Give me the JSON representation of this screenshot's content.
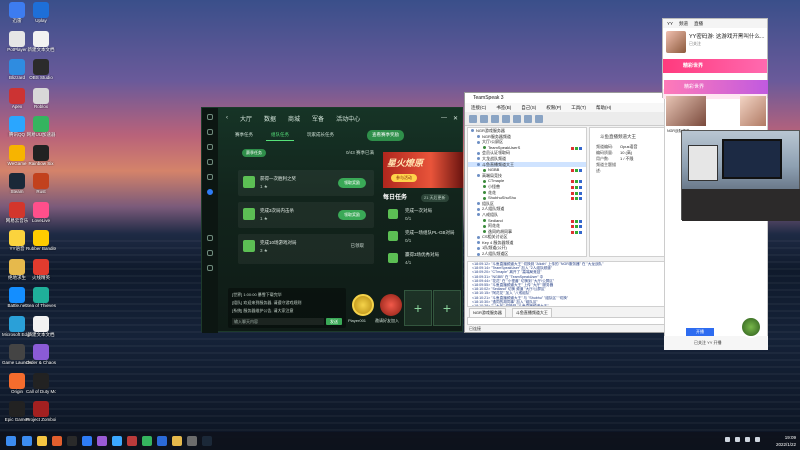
{
  "desktop": {
    "icons": [
      {
        "label": "迅雷",
        "color": "#3d7cf0"
      },
      {
        "label": "PotPlayer",
        "color": "#e6e6e6"
      },
      {
        "label": "Blizzard",
        "color": "#2f8ce0"
      },
      {
        "label": "Apex",
        "color": "#c33"
      },
      {
        "label": "腾讯QQ",
        "color": "#2aa6ff"
      },
      {
        "label": "WeGame",
        "color": "#f7b400"
      },
      {
        "label": "Steam",
        "color": "#1b2838"
      },
      {
        "label": "网易云音乐",
        "color": "#d3362c"
      },
      {
        "label": "YY语音",
        "color": "#fbd33d"
      },
      {
        "label": "绝地求生",
        "color": "#e6b94c"
      },
      {
        "label": "Battle.net",
        "color": "#148eff"
      },
      {
        "label": "Microsoft Edge",
        "color": "#2aa0d8"
      },
      {
        "label": "Game Launcher",
        "color": "#444"
      },
      {
        "label": "Origin",
        "color": "#f56c2d"
      },
      {
        "label": "Epic Games",
        "color": "#222"
      },
      {
        "label": "Uplay",
        "color": "#1e6fd8"
      },
      {
        "label": "新建文本文档",
        "color": "#f2f2f2"
      },
      {
        "label": "OBS Studio",
        "color": "#2b2b2b"
      },
      {
        "label": "Roblox",
        "color": "#d8d8d8"
      },
      {
        "label": "网易UU加速器",
        "color": "#35b45f"
      },
      {
        "label": "Rainbow Six",
        "color": "#222"
      },
      {
        "label": "Rust",
        "color": "#c2411d"
      },
      {
        "label": "LoveLive",
        "color": "#ff4f8b"
      },
      {
        "label": "Rubber Bandits",
        "color": "#ffcc00"
      },
      {
        "label": "火线精英",
        "color": "#e23b2e"
      },
      {
        "label": "Sea of Thieves",
        "color": "#1fb09a"
      },
      {
        "label": "新建文本文档",
        "color": "#f2f2f2"
      },
      {
        "label": "Order & Chaos",
        "color": "#8a5bd6"
      },
      {
        "label": "Call of Duty Modern...",
        "color": "#222"
      },
      {
        "label": "Project Zomboid",
        "color": "#a32020"
      }
    ]
  },
  "game": {
    "nav": [
      "大厅",
      "数据",
      "商城",
      "军备",
      "活动中心"
    ],
    "subtabs": [
      "赛季任务",
      "组队任务",
      "玩家成长任务"
    ],
    "subtab_button": "查看赛季奖励",
    "task_header_badge": "赛季任务",
    "task_header_count": "0/43 赛季已满",
    "tasks": [
      {
        "title": "获得一次胜利之奖",
        "progress": "1 ★",
        "action": "领取奖励"
      },
      {
        "title": "完成3次局内击杀",
        "progress": "1 ★",
        "action": "领取奖励"
      },
      {
        "title": "完成10场游戏对局",
        "progress": "3 ★",
        "action": "已领取"
      }
    ],
    "banner_title": "星火燎原",
    "banner_button": "参与活动",
    "daily_title": "每日任务",
    "daily_tag": "21 天后更新",
    "daily": [
      {
        "title": "完成一次对局",
        "progress": "0/1"
      },
      {
        "title": "完成一场组队PL-GB对局",
        "progress": "0/1"
      },
      {
        "title": "赢得3场优秀对局",
        "progress": "4/1"
      }
    ],
    "chat_lines": [
      "[世界] 1:00:00 暴雪下载完毕",
      "[组队] 欢迎来到服务器, 请遵守游戏规则",
      "[系统] 服务器维护公告, 请大家注意"
    ],
    "chat_placeholder": "输入聊天内容",
    "chat_send": "发送",
    "friend_1": "Player001",
    "friend_2": "邀请好友加入"
  },
  "teamspeak": {
    "title": "TeamSpeak 3",
    "menu": [
      "连接(C)",
      "书签(B)",
      "自己(S)",
      "权限(P)",
      "工具(T)",
      "帮助(H)"
    ],
    "tree": [
      {
        "label": "NGR游戏服务器",
        "hl": false,
        "indent": 0
      },
      {
        "label": "NGR服务器频道",
        "hl": false,
        "indent": 1
      },
      {
        "label": "大厅/公屏区",
        "hl": false,
        "indent": 1
      },
      {
        "label": "TeamSpeakUserS",
        "hl": false,
        "indent": 2
      },
      {
        "label": "会员认证领取码",
        "hl": false,
        "indent": 1
      },
      {
        "label": "大龙战队频道",
        "hl": false,
        "indent": 1
      },
      {
        "label": "斗鱼直播频道大王",
        "hl": true,
        "indent": 1
      },
      {
        "label": "NGBB",
        "hl": false,
        "indent": 2
      },
      {
        "label": "高端局竞技",
        "hl": false,
        "indent": 1
      },
      {
        "label": "CTmaple",
        "hl": false,
        "indent": 2
      },
      {
        "label": "小怪兽",
        "hl": false,
        "indent": 2
      },
      {
        "label": "花花",
        "hl": false,
        "indent": 2
      },
      {
        "label": "ShubhuShuShu",
        "hl": false,
        "indent": 2
      },
      {
        "label": "组队区",
        "hl": false,
        "indent": 1
      },
      {
        "label": "2人组队频道",
        "hl": false,
        "indent": 1
      },
      {
        "label": "八戒组队",
        "hl": false,
        "indent": 1
      },
      {
        "label": "Sedland",
        "hl": false,
        "indent": 2
      },
      {
        "label": "阿花花",
        "hl": false,
        "indent": 2
      },
      {
        "label": "逸同的胡同事",
        "hl": false,
        "indent": 2
      },
      {
        "label": "CS相关讨论区",
        "hl": false,
        "indent": 1
      },
      {
        "label": "Key 4 服务器频道",
        "hl": false,
        "indent": 1
      },
      {
        "label": "1队频道(公开)",
        "hl": false,
        "indent": 1
      },
      {
        "label": "2人组队频道区",
        "hl": false,
        "indent": 1
      }
    ],
    "info_title": "斗鱼直播频道大王",
    "info": [
      {
        "k": "频道编码:",
        "v": "Opus语音"
      },
      {
        "k": "编码质量:",
        "v": "10 (高)"
      },
      {
        "k": "用户数:",
        "v": "1 / 不限"
      },
      {
        "k": "频道主题描述:",
        "v": ""
      }
    ],
    "log": [
      "<18:09:12> \"斗鱼直播频道大王\" 切换到 \"Alioth\" 上传的 \"NGR服务器\" 在 \"大龙战队\"",
      "<18:09:14> \"TeamSpeakUser\" 加入 \"2人组队频道\"",
      "<18:09:20> \"CTmaple\" 离开了 \"高端局竞技\"",
      "<18:09:31> \"NGBB\" 在 \"TeamSpeakUser\" 中",
      "<18:09:44> \"花花\" 在 \"小怪兽\" 切换到 \"大厅/公屏区\"",
      "<18:09:55> \"斗鱼直播频道大王\" 上传 \"大厅\" 服务器",
      "<18:10:02> \"Sedland\" 切换 频道 \"大厅/公屏区\"",
      "<18:10:15> \"阿花花\" 加入 \"八戒组队\"",
      "<18:10:21> \"斗鱼直播频道大王\" 与 \"Shubhu\" \"组队区\" \"切换\"",
      "<18:10:30> \"逸同的胡同事\" 加入 \"组队区\"",
      "<18:10:38> \"\" \"大厅\" 切换到 \"斗鱼直播频道大王\""
    ],
    "tabs": [
      "NGR游戏服务器",
      "斗鱼直播频道大王"
    ],
    "status": "已连接"
  },
  "side": {
    "yy_tabs": [
      "YY",
      "频道",
      "直播"
    ],
    "yy_name": "YY密码游: 这游戏开黑叫什么...",
    "yy_sub": "已关注",
    "yy_banner": "精彩世界",
    "yy_banner2": "精彩世界",
    "yy_foot": "已关注 YY 开播",
    "yy_blue": "开播",
    "room_line": "NGR战队频道"
  },
  "taskbar": {
    "time": "19:09",
    "date": "2022/1/22",
    "apps": [
      "#3c8cf0",
      "#f4c542",
      "#e25f2e",
      "#2a2a2a",
      "#2e7cf6",
      "#9a5bd6",
      "#3ba8ff",
      "#bb3b3b",
      "#35b45f",
      "#2b6ad8",
      "#e6b94c",
      "#6c6c6c",
      "#1b2838"
    ]
  }
}
